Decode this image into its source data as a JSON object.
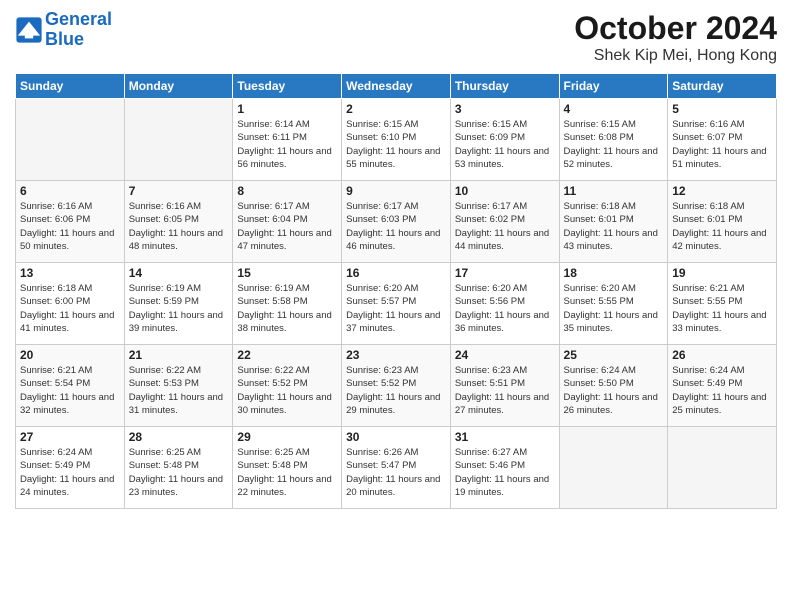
{
  "logo": {
    "line1": "General",
    "line2": "Blue"
  },
  "title": "October 2024",
  "location": "Shek Kip Mei, Hong Kong",
  "days_header": [
    "Sunday",
    "Monday",
    "Tuesday",
    "Wednesday",
    "Thursday",
    "Friday",
    "Saturday"
  ],
  "weeks": [
    [
      {
        "day": "",
        "sunrise": "",
        "sunset": "",
        "daylight": ""
      },
      {
        "day": "",
        "sunrise": "",
        "sunset": "",
        "daylight": ""
      },
      {
        "day": "1",
        "sunrise": "Sunrise: 6:14 AM",
        "sunset": "Sunset: 6:11 PM",
        "daylight": "Daylight: 11 hours and 56 minutes."
      },
      {
        "day": "2",
        "sunrise": "Sunrise: 6:15 AM",
        "sunset": "Sunset: 6:10 PM",
        "daylight": "Daylight: 11 hours and 55 minutes."
      },
      {
        "day": "3",
        "sunrise": "Sunrise: 6:15 AM",
        "sunset": "Sunset: 6:09 PM",
        "daylight": "Daylight: 11 hours and 53 minutes."
      },
      {
        "day": "4",
        "sunrise": "Sunrise: 6:15 AM",
        "sunset": "Sunset: 6:08 PM",
        "daylight": "Daylight: 11 hours and 52 minutes."
      },
      {
        "day": "5",
        "sunrise": "Sunrise: 6:16 AM",
        "sunset": "Sunset: 6:07 PM",
        "daylight": "Daylight: 11 hours and 51 minutes."
      }
    ],
    [
      {
        "day": "6",
        "sunrise": "Sunrise: 6:16 AM",
        "sunset": "Sunset: 6:06 PM",
        "daylight": "Daylight: 11 hours and 50 minutes."
      },
      {
        "day": "7",
        "sunrise": "Sunrise: 6:16 AM",
        "sunset": "Sunset: 6:05 PM",
        "daylight": "Daylight: 11 hours and 48 minutes."
      },
      {
        "day": "8",
        "sunrise": "Sunrise: 6:17 AM",
        "sunset": "Sunset: 6:04 PM",
        "daylight": "Daylight: 11 hours and 47 minutes."
      },
      {
        "day": "9",
        "sunrise": "Sunrise: 6:17 AM",
        "sunset": "Sunset: 6:03 PM",
        "daylight": "Daylight: 11 hours and 46 minutes."
      },
      {
        "day": "10",
        "sunrise": "Sunrise: 6:17 AM",
        "sunset": "Sunset: 6:02 PM",
        "daylight": "Daylight: 11 hours and 44 minutes."
      },
      {
        "day": "11",
        "sunrise": "Sunrise: 6:18 AM",
        "sunset": "Sunset: 6:01 PM",
        "daylight": "Daylight: 11 hours and 43 minutes."
      },
      {
        "day": "12",
        "sunrise": "Sunrise: 6:18 AM",
        "sunset": "Sunset: 6:01 PM",
        "daylight": "Daylight: 11 hours and 42 minutes."
      }
    ],
    [
      {
        "day": "13",
        "sunrise": "Sunrise: 6:18 AM",
        "sunset": "Sunset: 6:00 PM",
        "daylight": "Daylight: 11 hours and 41 minutes."
      },
      {
        "day": "14",
        "sunrise": "Sunrise: 6:19 AM",
        "sunset": "Sunset: 5:59 PM",
        "daylight": "Daylight: 11 hours and 39 minutes."
      },
      {
        "day": "15",
        "sunrise": "Sunrise: 6:19 AM",
        "sunset": "Sunset: 5:58 PM",
        "daylight": "Daylight: 11 hours and 38 minutes."
      },
      {
        "day": "16",
        "sunrise": "Sunrise: 6:20 AM",
        "sunset": "Sunset: 5:57 PM",
        "daylight": "Daylight: 11 hours and 37 minutes."
      },
      {
        "day": "17",
        "sunrise": "Sunrise: 6:20 AM",
        "sunset": "Sunset: 5:56 PM",
        "daylight": "Daylight: 11 hours and 36 minutes."
      },
      {
        "day": "18",
        "sunrise": "Sunrise: 6:20 AM",
        "sunset": "Sunset: 5:55 PM",
        "daylight": "Daylight: 11 hours and 35 minutes."
      },
      {
        "day": "19",
        "sunrise": "Sunrise: 6:21 AM",
        "sunset": "Sunset: 5:55 PM",
        "daylight": "Daylight: 11 hours and 33 minutes."
      }
    ],
    [
      {
        "day": "20",
        "sunrise": "Sunrise: 6:21 AM",
        "sunset": "Sunset: 5:54 PM",
        "daylight": "Daylight: 11 hours and 32 minutes."
      },
      {
        "day": "21",
        "sunrise": "Sunrise: 6:22 AM",
        "sunset": "Sunset: 5:53 PM",
        "daylight": "Daylight: 11 hours and 31 minutes."
      },
      {
        "day": "22",
        "sunrise": "Sunrise: 6:22 AM",
        "sunset": "Sunset: 5:52 PM",
        "daylight": "Daylight: 11 hours and 30 minutes."
      },
      {
        "day": "23",
        "sunrise": "Sunrise: 6:23 AM",
        "sunset": "Sunset: 5:52 PM",
        "daylight": "Daylight: 11 hours and 29 minutes."
      },
      {
        "day": "24",
        "sunrise": "Sunrise: 6:23 AM",
        "sunset": "Sunset: 5:51 PM",
        "daylight": "Daylight: 11 hours and 27 minutes."
      },
      {
        "day": "25",
        "sunrise": "Sunrise: 6:24 AM",
        "sunset": "Sunset: 5:50 PM",
        "daylight": "Daylight: 11 hours and 26 minutes."
      },
      {
        "day": "26",
        "sunrise": "Sunrise: 6:24 AM",
        "sunset": "Sunset: 5:49 PM",
        "daylight": "Daylight: 11 hours and 25 minutes."
      }
    ],
    [
      {
        "day": "27",
        "sunrise": "Sunrise: 6:24 AM",
        "sunset": "Sunset: 5:49 PM",
        "daylight": "Daylight: 11 hours and 24 minutes."
      },
      {
        "day": "28",
        "sunrise": "Sunrise: 6:25 AM",
        "sunset": "Sunset: 5:48 PM",
        "daylight": "Daylight: 11 hours and 23 minutes."
      },
      {
        "day": "29",
        "sunrise": "Sunrise: 6:25 AM",
        "sunset": "Sunset: 5:48 PM",
        "daylight": "Daylight: 11 hours and 22 minutes."
      },
      {
        "day": "30",
        "sunrise": "Sunrise: 6:26 AM",
        "sunset": "Sunset: 5:47 PM",
        "daylight": "Daylight: 11 hours and 20 minutes."
      },
      {
        "day": "31",
        "sunrise": "Sunrise: 6:27 AM",
        "sunset": "Sunset: 5:46 PM",
        "daylight": "Daylight: 11 hours and 19 minutes."
      },
      {
        "day": "",
        "sunrise": "",
        "sunset": "",
        "daylight": ""
      },
      {
        "day": "",
        "sunrise": "",
        "sunset": "",
        "daylight": ""
      }
    ]
  ]
}
